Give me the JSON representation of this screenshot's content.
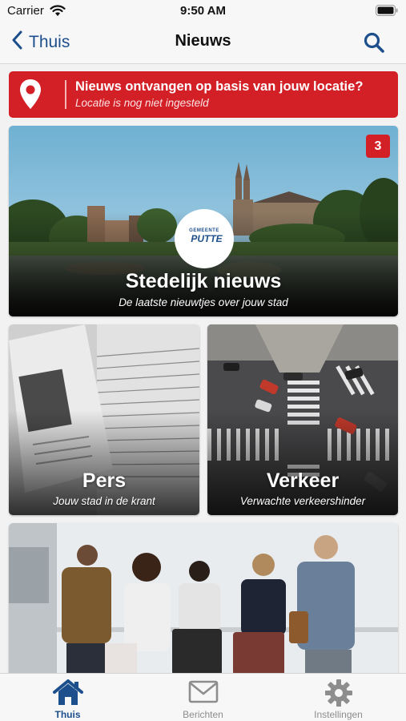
{
  "status_bar": {
    "carrier": "Carrier",
    "time": "9:50 AM"
  },
  "nav": {
    "back_label": "Thuis",
    "title": "Nieuws",
    "back_icon": "chevron-left-icon",
    "search_icon": "search-icon"
  },
  "location_banner": {
    "title": "Nieuws ontvangen op basis van jouw locatie?",
    "subtitle": "Locatie is nog niet ingesteld",
    "icon": "location-pin-icon",
    "color": "#d31f26"
  },
  "cards": {
    "main": {
      "title": "Stedelijk nieuws",
      "subtitle": "De laatste nieuwtjes over jouw stad",
      "badge": "3",
      "logo_small": "GEMEENTE",
      "logo_text": "PUTTE"
    },
    "pers": {
      "title": "Pers",
      "subtitle": "Jouw stad in de krant"
    },
    "verkeer": {
      "title": "Verkeer",
      "subtitle": "Verwachte verkeershinder"
    }
  },
  "tabs": [
    {
      "label": "Thuis",
      "icon": "home-icon",
      "active": true
    },
    {
      "label": "Berichten",
      "icon": "envelope-icon",
      "active": false
    },
    {
      "label": "Instellingen",
      "icon": "gear-icon",
      "active": false
    }
  ],
  "colors": {
    "accent": "#1c4f8c",
    "alert": "#d31f26",
    "tab_inactive": "#8d8d8d"
  }
}
